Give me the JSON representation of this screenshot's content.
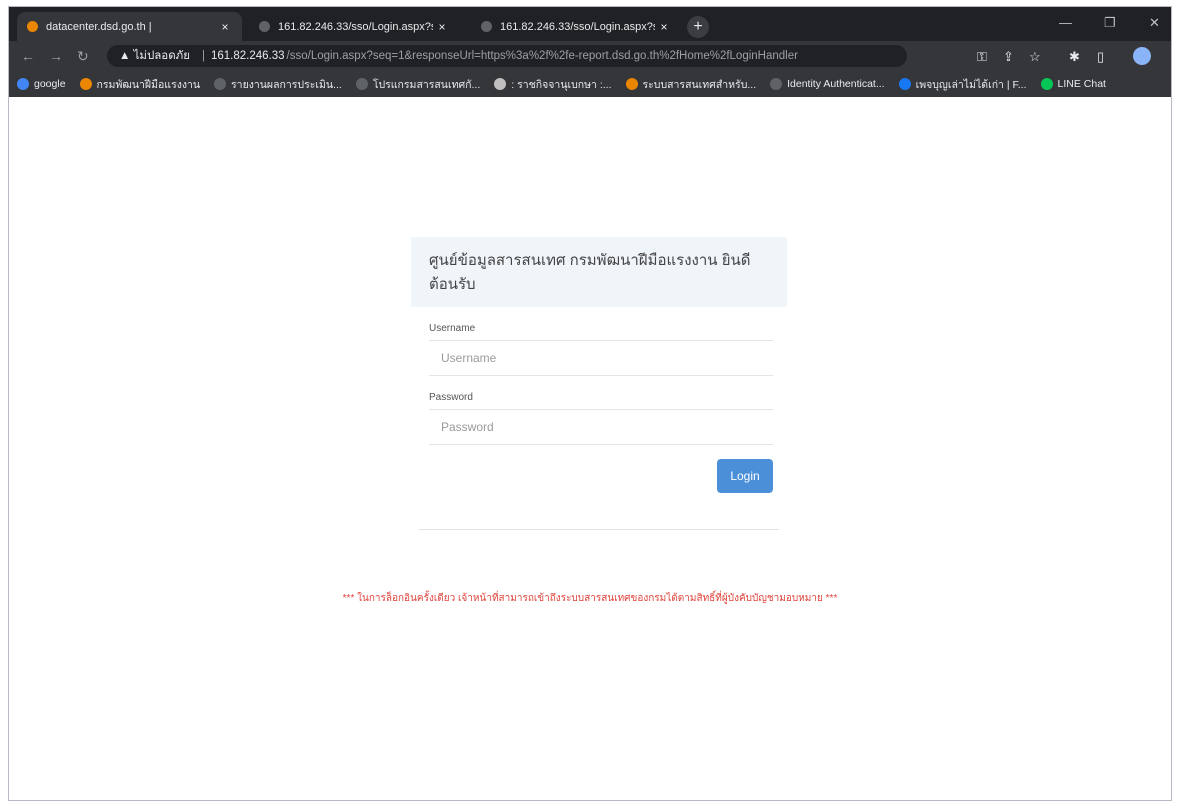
{
  "browser": {
    "tabs": [
      {
        "title": "datacenter.dsd.go.th |",
        "close": "×"
      },
      {
        "title": "161.82.246.33/sso/Login.aspx?se",
        "close": "×"
      },
      {
        "title": "161.82.246.33/sso/Login.aspx?se",
        "close": "×"
      }
    ],
    "new_tab": "+",
    "window_controls": {
      "minimize": "—",
      "restore": "❐",
      "close": "✕"
    },
    "security_warning": "▲ ไม่ปลอดภัย",
    "url_host": "161.82.246.33",
    "url_path": "/sso/Login.aspx?seq=1&responseUrl=https%3a%2f%2fe-report.dsd.go.th%2fHome%2fLoginHandler",
    "bookmarks": [
      {
        "label": "google",
        "color": "#4285f4"
      },
      {
        "label": "กรมพัฒนาฝีมือแรงงาน",
        "color": "#ea8600"
      },
      {
        "label": "รายงานผลการประเมิน...",
        "color": "#5f6368"
      },
      {
        "label": "โปรแกรมสารสนเทศกั...",
        "color": "#5f6368"
      },
      {
        "label": ": ราชกิจจานุเบกษา :...",
        "color": "#c0c0c0"
      },
      {
        "label": "ระบบสารสนเทศสำหรับ...",
        "color": "#ea8600"
      },
      {
        "label": "Identity Authenticat...",
        "color": "#5f6368"
      },
      {
        "label": "เพจบุญเล่าไม่ได้เก่า | F...",
        "color": "#1877f2"
      },
      {
        "label": "LINE Chat",
        "color": "#06c755"
      }
    ]
  },
  "login": {
    "header": "ศูนย์ข้อมูลสารสนเทศ กรมพัฒนาฝีมือแรงงาน ยินดีต้อนรับ",
    "username_label": "Username",
    "username_placeholder": "Username",
    "password_label": "Password",
    "password_placeholder": "Password",
    "login_button": "Login",
    "notice": "*** ในการล็อกอินครั้งเดียว เจ้าหน้าที่สามารถเข้าถึงระบบสารสนเทศของกรมได้ตามสิทธิ์ที่ผู้บังคับบัญชามอบหมาย ***"
  },
  "colors": {
    "accent": "#4a8fd8",
    "notice": "#e0433a",
    "panel_header_bg": "#f0f5fa"
  }
}
